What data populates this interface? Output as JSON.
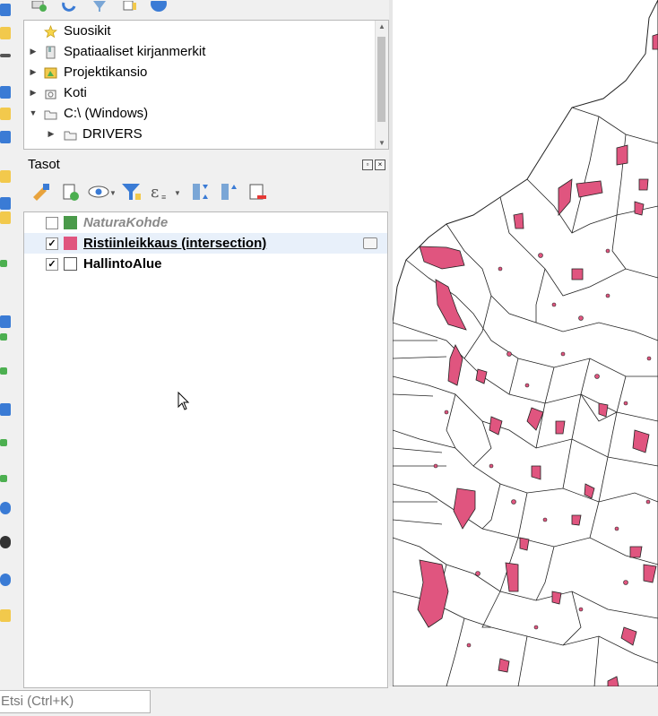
{
  "browser": {
    "items": [
      {
        "label": "Suosikit",
        "icon": "star-icon",
        "expandable": false
      },
      {
        "label": "Spatiaaliset kirjanmerkit",
        "icon": "bookmark-icon",
        "expandable": true
      },
      {
        "label": "Projektikansio",
        "icon": "project-folder-icon",
        "expandable": true
      },
      {
        "label": "Koti",
        "icon": "home-icon",
        "expandable": true
      },
      {
        "label": "C:\\ (Windows)",
        "icon": "drive-icon",
        "expandable": true,
        "expanded": true
      },
      {
        "label": "DRIVERS",
        "icon": "folder-icon",
        "expandable": true,
        "child": true
      }
    ]
  },
  "layers_panel": {
    "title": "Tasot",
    "layers": [
      {
        "name": "NaturaKohde",
        "checked": false,
        "color": "#4a9a4a",
        "style": "italic-gray"
      },
      {
        "name": "Ristiinleikkaus (intersection)",
        "checked": true,
        "color": "#e0557f",
        "style": "underlined"
      },
      {
        "name": "HallintoAlue",
        "checked": true,
        "color": "#ffffff",
        "style": "bold"
      }
    ]
  },
  "status": {
    "search_placeholder": "Etsi (Ctrl+K)"
  },
  "colors": {
    "accent_pink": "#e0557f",
    "map_outline": "#222222"
  }
}
